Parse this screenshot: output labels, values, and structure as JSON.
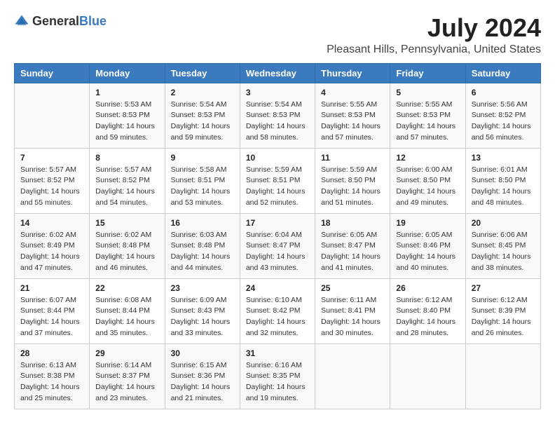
{
  "logo": {
    "text_general": "General",
    "text_blue": "Blue"
  },
  "title": "July 2024",
  "subtitle": "Pleasant Hills, Pennsylvania, United States",
  "days_of_week": [
    "Sunday",
    "Monday",
    "Tuesday",
    "Wednesday",
    "Thursday",
    "Friday",
    "Saturday"
  ],
  "weeks": [
    [
      {
        "day": "",
        "content": ""
      },
      {
        "day": "1",
        "content": "Sunrise: 5:53 AM\nSunset: 8:53 PM\nDaylight: 14 hours\nand 59 minutes."
      },
      {
        "day": "2",
        "content": "Sunrise: 5:54 AM\nSunset: 8:53 PM\nDaylight: 14 hours\nand 59 minutes."
      },
      {
        "day": "3",
        "content": "Sunrise: 5:54 AM\nSunset: 8:53 PM\nDaylight: 14 hours\nand 58 minutes."
      },
      {
        "day": "4",
        "content": "Sunrise: 5:55 AM\nSunset: 8:53 PM\nDaylight: 14 hours\nand 57 minutes."
      },
      {
        "day": "5",
        "content": "Sunrise: 5:55 AM\nSunset: 8:53 PM\nDaylight: 14 hours\nand 57 minutes."
      },
      {
        "day": "6",
        "content": "Sunrise: 5:56 AM\nSunset: 8:52 PM\nDaylight: 14 hours\nand 56 minutes."
      }
    ],
    [
      {
        "day": "7",
        "content": "Sunrise: 5:57 AM\nSunset: 8:52 PM\nDaylight: 14 hours\nand 55 minutes."
      },
      {
        "day": "8",
        "content": "Sunrise: 5:57 AM\nSunset: 8:52 PM\nDaylight: 14 hours\nand 54 minutes."
      },
      {
        "day": "9",
        "content": "Sunrise: 5:58 AM\nSunset: 8:51 PM\nDaylight: 14 hours\nand 53 minutes."
      },
      {
        "day": "10",
        "content": "Sunrise: 5:59 AM\nSunset: 8:51 PM\nDaylight: 14 hours\nand 52 minutes."
      },
      {
        "day": "11",
        "content": "Sunrise: 5:59 AM\nSunset: 8:50 PM\nDaylight: 14 hours\nand 51 minutes."
      },
      {
        "day": "12",
        "content": "Sunrise: 6:00 AM\nSunset: 8:50 PM\nDaylight: 14 hours\nand 49 minutes."
      },
      {
        "day": "13",
        "content": "Sunrise: 6:01 AM\nSunset: 8:50 PM\nDaylight: 14 hours\nand 48 minutes."
      }
    ],
    [
      {
        "day": "14",
        "content": "Sunrise: 6:02 AM\nSunset: 8:49 PM\nDaylight: 14 hours\nand 47 minutes."
      },
      {
        "day": "15",
        "content": "Sunrise: 6:02 AM\nSunset: 8:48 PM\nDaylight: 14 hours\nand 46 minutes."
      },
      {
        "day": "16",
        "content": "Sunrise: 6:03 AM\nSunset: 8:48 PM\nDaylight: 14 hours\nand 44 minutes."
      },
      {
        "day": "17",
        "content": "Sunrise: 6:04 AM\nSunset: 8:47 PM\nDaylight: 14 hours\nand 43 minutes."
      },
      {
        "day": "18",
        "content": "Sunrise: 6:05 AM\nSunset: 8:47 PM\nDaylight: 14 hours\nand 41 minutes."
      },
      {
        "day": "19",
        "content": "Sunrise: 6:05 AM\nSunset: 8:46 PM\nDaylight: 14 hours\nand 40 minutes."
      },
      {
        "day": "20",
        "content": "Sunrise: 6:06 AM\nSunset: 8:45 PM\nDaylight: 14 hours\nand 38 minutes."
      }
    ],
    [
      {
        "day": "21",
        "content": "Sunrise: 6:07 AM\nSunset: 8:44 PM\nDaylight: 14 hours\nand 37 minutes."
      },
      {
        "day": "22",
        "content": "Sunrise: 6:08 AM\nSunset: 8:44 PM\nDaylight: 14 hours\nand 35 minutes."
      },
      {
        "day": "23",
        "content": "Sunrise: 6:09 AM\nSunset: 8:43 PM\nDaylight: 14 hours\nand 33 minutes."
      },
      {
        "day": "24",
        "content": "Sunrise: 6:10 AM\nSunset: 8:42 PM\nDaylight: 14 hours\nand 32 minutes."
      },
      {
        "day": "25",
        "content": "Sunrise: 6:11 AM\nSunset: 8:41 PM\nDaylight: 14 hours\nand 30 minutes."
      },
      {
        "day": "26",
        "content": "Sunrise: 6:12 AM\nSunset: 8:40 PM\nDaylight: 14 hours\nand 28 minutes."
      },
      {
        "day": "27",
        "content": "Sunrise: 6:12 AM\nSunset: 8:39 PM\nDaylight: 14 hours\nand 26 minutes."
      }
    ],
    [
      {
        "day": "28",
        "content": "Sunrise: 6:13 AM\nSunset: 8:38 PM\nDaylight: 14 hours\nand 25 minutes."
      },
      {
        "day": "29",
        "content": "Sunrise: 6:14 AM\nSunset: 8:37 PM\nDaylight: 14 hours\nand 23 minutes."
      },
      {
        "day": "30",
        "content": "Sunrise: 6:15 AM\nSunset: 8:36 PM\nDaylight: 14 hours\nand 21 minutes."
      },
      {
        "day": "31",
        "content": "Sunrise: 6:16 AM\nSunset: 8:35 PM\nDaylight: 14 hours\nand 19 minutes."
      },
      {
        "day": "",
        "content": ""
      },
      {
        "day": "",
        "content": ""
      },
      {
        "day": "",
        "content": ""
      }
    ]
  ]
}
